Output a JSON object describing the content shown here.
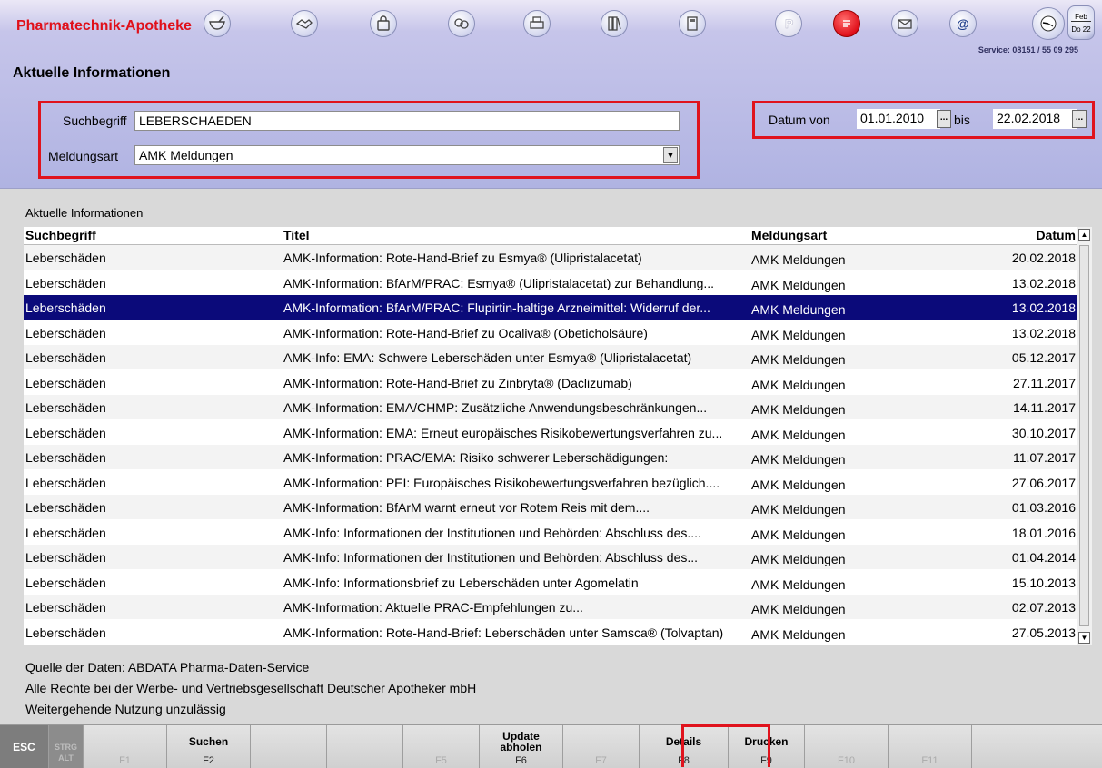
{
  "app": {
    "title": "Pharmatechnik-Apotheke",
    "service": "Service: 08151 / 55 09 295",
    "page_title": "Aktuelle Informationen",
    "toolbar_icons": [
      "mortar-icon",
      "handshake-icon",
      "shopping-bag-icon",
      "faces-icon",
      "printer-icon",
      "books-icon",
      "calculator-icon",
      "p-logo-icon",
      "chat-icon",
      "envelope-icon",
      "at-icon",
      "clock-icon",
      "calendar-icon"
    ],
    "calendar": {
      "month": "Feb",
      "day": "Do 22"
    }
  },
  "search": {
    "suchbegriff_label": "Suchbegriff",
    "suchbegriff_value": "LEBERSCHAEDEN",
    "meldungsart_label": "Meldungsart",
    "meldungsart_value": "AMK Meldungen",
    "datum_von_label": "Datum von",
    "datum_von_value": "01.01.2010",
    "bis_label": "bis",
    "datum_bis_value": "22.02.2018",
    "browse_label": "..."
  },
  "list": {
    "caption": "Aktuelle Informationen",
    "columns": [
      "Suchbegriff",
      "Titel",
      "Meldungsart",
      "Datum"
    ],
    "selected_index": 2,
    "rows": [
      {
        "suchbegriff": "Leberschäden",
        "titel": "AMK-Information: Rote-Hand-Brief zu Esmya® (Ulipristalacetat)",
        "meldungsart": "AMK Meldungen",
        "datum": "20.02.2018"
      },
      {
        "suchbegriff": "Leberschäden",
        "titel": "AMK-Information: BfArM/PRAC: Esmya® (Ulipristalacetat) zur Behandlung...",
        "meldungsart": "AMK Meldungen",
        "datum": "13.02.2018"
      },
      {
        "suchbegriff": "Leberschäden",
        "titel": "AMK-Information: BfArM/PRAC: Flupirtin-haltige Arzneimittel: Widerruf der...",
        "meldungsart": "AMK Meldungen",
        "datum": "13.02.2018"
      },
      {
        "suchbegriff": "Leberschäden",
        "titel": "AMK-Information: Rote-Hand-Brief zu Ocaliva® (Obeticholsäure)",
        "meldungsart": "AMK Meldungen",
        "datum": "13.02.2018"
      },
      {
        "suchbegriff": "Leberschäden",
        "titel": "AMK-Info: EMA: Schwere Leberschäden unter Esmya® (Ulipristalacetat)",
        "meldungsart": "AMK Meldungen",
        "datum": "05.12.2017"
      },
      {
        "suchbegriff": "Leberschäden",
        "titel": "AMK-Information: Rote-Hand-Brief zu Zinbryta® (Daclizumab)",
        "meldungsart": "AMK Meldungen",
        "datum": "27.11.2017"
      },
      {
        "suchbegriff": "Leberschäden",
        "titel": "AMK-Information: EMA/CHMP: Zusätzliche Anwendungsbeschränkungen...",
        "meldungsart": "AMK Meldungen",
        "datum": "14.11.2017"
      },
      {
        "suchbegriff": "Leberschäden",
        "titel": "AMK-Information: EMA: Erneut europäisches Risikobewertungsverfahren zu...",
        "meldungsart": "AMK Meldungen",
        "datum": "30.10.2017"
      },
      {
        "suchbegriff": "Leberschäden",
        "titel": "AMK-Information: PRAC/EMA: Risiko schwerer Leberschädigungen:",
        "meldungsart": "AMK Meldungen",
        "datum": "11.07.2017"
      },
      {
        "suchbegriff": "Leberschäden",
        "titel": "AMK-Information: PEI: Europäisches Risikobewertungsverfahren bezüglich....",
        "meldungsart": "AMK Meldungen",
        "datum": "27.06.2017"
      },
      {
        "suchbegriff": "Leberschäden",
        "titel": "AMK-Information: BfArM warnt erneut vor Rotem Reis mit dem....",
        "meldungsart": "AMK Meldungen",
        "datum": "01.03.2016"
      },
      {
        "suchbegriff": "Leberschäden",
        "titel": "AMK-Info: Informationen der Institutionen und Behörden: Abschluss des....",
        "meldungsart": "AMK Meldungen",
        "datum": "18.01.2016"
      },
      {
        "suchbegriff": "Leberschäden",
        "titel": "AMK-Info: Informationen der Institutionen und Behörden: Abschluss des...",
        "meldungsart": "AMK Meldungen",
        "datum": "01.04.2014"
      },
      {
        "suchbegriff": "Leberschäden",
        "titel": "AMK-Info: Informationsbrief zu Leberschäden unter Agomelatin",
        "meldungsart": "AMK Meldungen",
        "datum": "15.10.2013"
      },
      {
        "suchbegriff": "Leberschäden",
        "titel": "AMK-Information: Aktuelle PRAC-Empfehlungen zu...",
        "meldungsart": "AMK Meldungen",
        "datum": "02.07.2013"
      },
      {
        "suchbegriff": "Leberschäden",
        "titel": "AMK-Information: Rote-Hand-Brief: Leberschäden unter Samsca® (Tolvaptan)",
        "meldungsart": "AMK Meldungen",
        "datum": "27.05.2013"
      }
    ]
  },
  "source": {
    "line1": "Quelle der Daten: ABDATA Pharma-Daten-Service",
    "line2": "Alle Rechte bei der Werbe- und Vertriebsgesellschaft Deutscher Apotheker mbH",
    "line3": "Weitergehende Nutzung unzulässig"
  },
  "fkeys": [
    {
      "label": "ESC",
      "key": "",
      "type": "esc"
    },
    {
      "label": "STRG ALT",
      "key": "",
      "type": "strg"
    },
    {
      "label": "",
      "key": "F1",
      "dim": true
    },
    {
      "label": "Suchen",
      "key": "F2",
      "dim": false
    },
    {
      "label": "",
      "key": "",
      "dim": true
    },
    {
      "label": "",
      "key": "",
      "dim": true
    },
    {
      "label": "",
      "key": "F5",
      "dim": true
    },
    {
      "label": "Update abholen",
      "key": "F6",
      "dim": false
    },
    {
      "label": "",
      "key": "F7",
      "dim": true
    },
    {
      "label": "Details",
      "key": "F8",
      "dim": false
    },
    {
      "label": "Drucken",
      "key": "F9",
      "dim": false
    },
    {
      "label": "",
      "key": "F10",
      "dim": true
    },
    {
      "label": "",
      "key": "F11",
      "dim": true
    },
    {
      "label": "",
      "key": "",
      "dim": true
    }
  ],
  "colors": {
    "brand": "#e0101a",
    "highlight": "#e0131d",
    "selection": "#0b0a7a"
  }
}
